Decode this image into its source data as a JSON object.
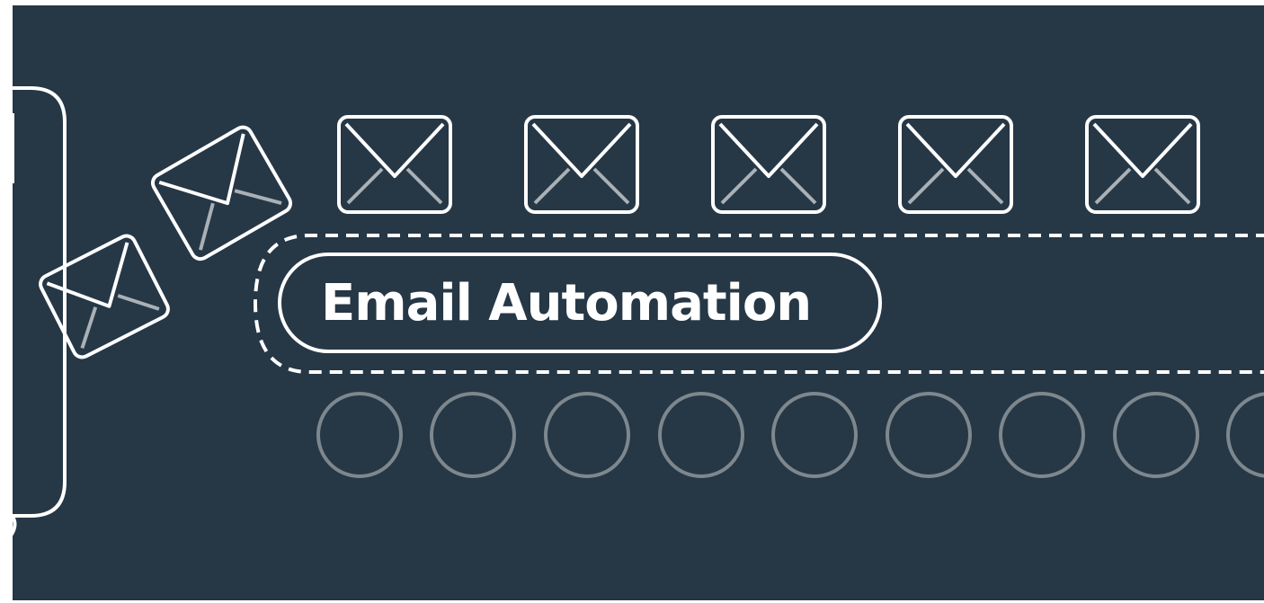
{
  "banner": {
    "title": "Email Automation"
  },
  "colors": {
    "background": "#263746",
    "stroke": "#ffffff",
    "inner_fold": "#a9b1b6",
    "token": "#7d878e"
  },
  "icons": {
    "envelope": "envelope-icon",
    "queue_token": "circle-outline-icon",
    "device": "phone-outline"
  },
  "envelope_queue_count": 5,
  "token_count": 9
}
